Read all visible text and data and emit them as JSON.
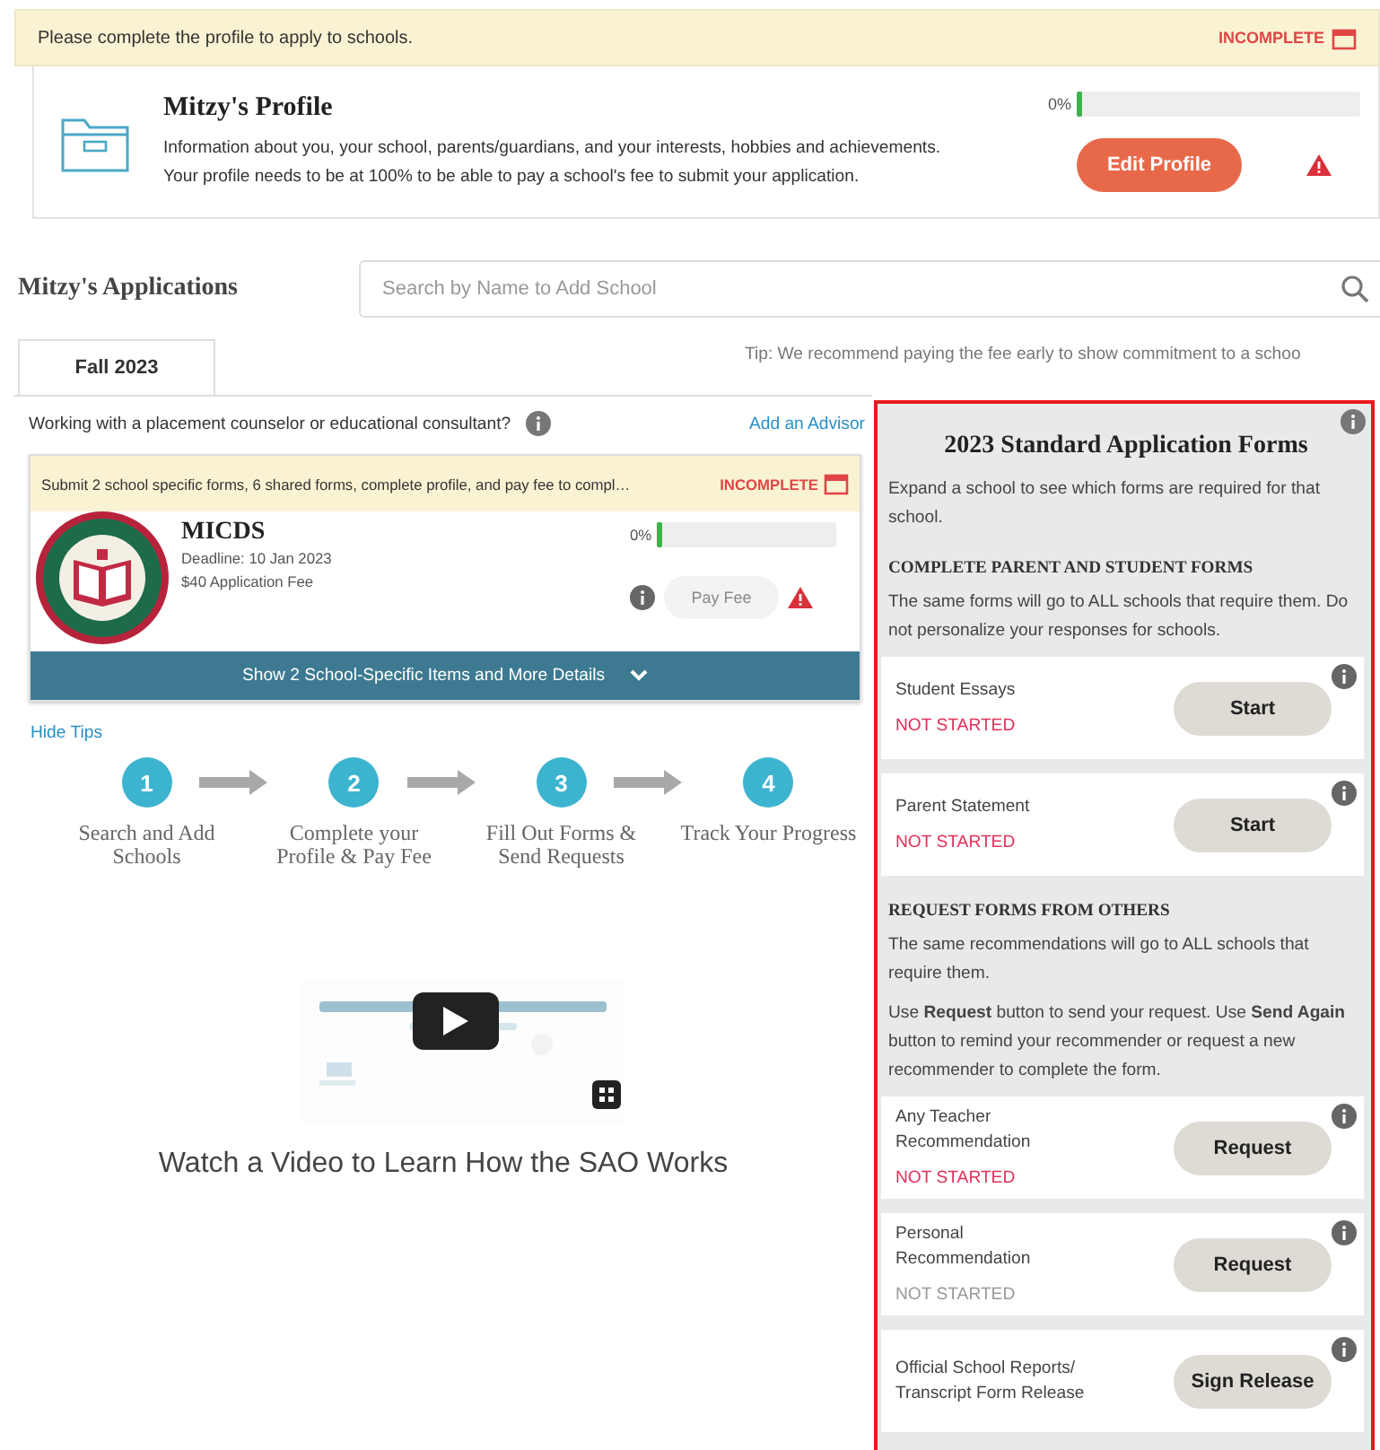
{
  "banner": {
    "message": "Please complete the profile to apply to schools.",
    "status": "INCOMPLETE"
  },
  "profile": {
    "title": "Mitzy's Profile",
    "description": [
      "Information about you, your school, parents/guardians, and your interests, hobbies and achievements.",
      "Your profile needs to be at 100% to be able to pay a school's fee to submit your application."
    ],
    "progress_label": "0%",
    "level": 0,
    "button": "Edit Profile"
  },
  "applications": {
    "title": "Mitzy's Applications",
    "search": {
      "placeholder": "Search by Name to Add School"
    },
    "tabs": [
      {
        "label": "Fall 2023",
        "selected": true
      }
    ],
    "tip": "Tip: We recommend paying the fee early to show commitment to a schoo",
    "advisor_prompt": "Working with a placement counselor or educational consultant?",
    "advisor_link": "Add an Advisor",
    "schools": [
      {
        "notice": "Submit 2 school specific forms, 6 shared forms, complete profile, and pay fee to compl…",
        "status": "INCOMPLETE",
        "name": "MICDS",
        "deadline": "Deadline: 10 Jan 2023",
        "fee": "$40 Application Fee",
        "progress_label": "0%",
        "level": 0,
        "pay_button": "Pay Fee",
        "pay_disabled": true,
        "details_button": "Show 2 School-Specific Items and More Details"
      }
    ],
    "hide_tips": "Hide Tips",
    "steps": [
      {
        "number": "1",
        "label": "Search and Add Schools"
      },
      {
        "number": "2",
        "label": "Complete your Profile & Pay Fee"
      },
      {
        "number": "3",
        "label": "Fill Out Forms & Send Requests"
      },
      {
        "number": "4",
        "label": "Track Your Progress"
      }
    ],
    "video": {
      "kind": "picture",
      "caption": "Watch a Video to Learn How the SAO Works"
    }
  },
  "forms_panel": {
    "title": "2023 Standard Application Forms",
    "intro": "Expand a school to see which forms are required for that school.",
    "sections": [
      {
        "heading": "COMPLETE PARENT AND STUDENT FORMS",
        "notes": [
          "The same forms will go to ALL schools that require them. Do not personalize your responses for schools."
        ],
        "forms": [
          {
            "name": "Student Essays",
            "status": "NOT STARTED",
            "color": "#e0315a",
            "button": "Start"
          },
          {
            "name": "Parent Statement",
            "status": "NOT STARTED",
            "color": "#e0315a",
            "button": "Start"
          }
        ]
      },
      {
        "heading": "REQUEST FORMS FROM OTHERS",
        "notes": [
          "The same recommendations will go to ALL schools that require them.",
          "Use **Request** button to send your request. Use **Send Again** button to remind your recommender or request a new recommender to complete the form."
        ],
        "forms": [
          {
            "name": "Any Teacher Recommendation",
            "status": "NOT STARTED",
            "color": "#e0315a",
            "button": "Request"
          },
          {
            "name": "Personal Recommendation",
            "status": "NOT STARTED",
            "color": "#999999",
            "button": "Request"
          },
          {
            "name": "Official School Reports/ Transcript Form Release",
            "button": "Sign Release"
          }
        ]
      }
    ]
  }
}
